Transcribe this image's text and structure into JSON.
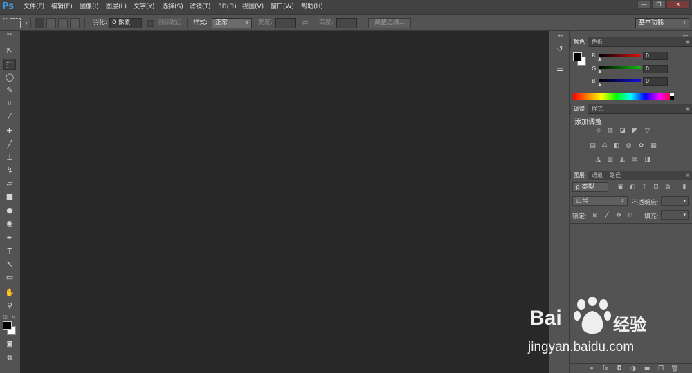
{
  "app": {
    "logo": "Ps"
  },
  "menu": {
    "items": [
      "文件(F)",
      "编辑(E)",
      "图像(I)",
      "图层(L)",
      "文字(Y)",
      "选择(S)",
      "滤镜(T)",
      "3D(D)",
      "视图(V)",
      "窗口(W)",
      "帮助(H)"
    ]
  },
  "window_controls": {
    "minimize": "—",
    "restore": "❐",
    "close": "✕"
  },
  "options": {
    "feather_label": "羽化:",
    "feather_value": "0 像素",
    "antialias_label": "消除锯齿",
    "style_label": "样式:",
    "style_value": "正常",
    "width_label": "宽度:",
    "height_label": "高度:",
    "refine_edge": "调整边缘...",
    "workspace": "基本功能"
  },
  "color_panel": {
    "tabs": [
      "颜色",
      "色板"
    ],
    "channels": [
      {
        "label": "R",
        "value": "0",
        "color": "#e01010"
      },
      {
        "label": "G",
        "value": "0",
        "color": "#10c010"
      },
      {
        "label": "B",
        "value": "0",
        "color": "#1010e0"
      }
    ]
  },
  "adjust_panel": {
    "tabs": [
      "调整",
      "样式"
    ],
    "title": "添加调整"
  },
  "layers_panel": {
    "tabs": [
      "图层",
      "通道",
      "路径"
    ],
    "filter_label": "ρ 类型",
    "blend_mode": "正常",
    "opacity_label": "不透明度:",
    "lock_label": "锁定:",
    "fill_label": "填充:"
  },
  "watermark": {
    "brand": "Bai",
    "brand_suffix": "经验",
    "url": "jingyan.baidu.com"
  },
  "colors": {
    "menubar": "#424242",
    "panel": "#535353",
    "canvas": "#282828",
    "accent": "#3a9ce6"
  }
}
